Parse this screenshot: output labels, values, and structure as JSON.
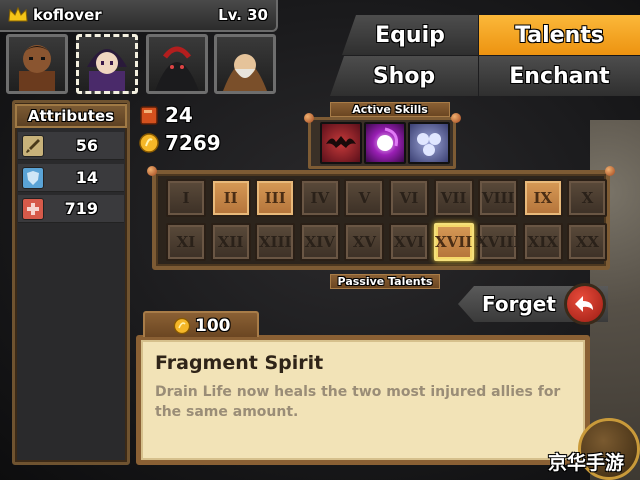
{
  "player": {
    "name": "koflover",
    "level": "Lv. 30",
    "heroes": [
      {
        "name": "hero-warrior"
      },
      {
        "name": "hero-mage",
        "selected": true
      },
      {
        "name": "hero-hooded"
      },
      {
        "name": "hero-monk"
      }
    ]
  },
  "tabs": {
    "equip": "Equip",
    "talents": "Talents",
    "shop": "Shop",
    "enchant": "Enchant",
    "active": "Talents"
  },
  "attributes": {
    "header": "Attributes",
    "rows": [
      {
        "icon": "sword-icon",
        "value": "56",
        "color": "#c8b27a"
      },
      {
        "icon": "shield-icon",
        "value": "14",
        "color": "#5aa3d6"
      },
      {
        "icon": "health-cross-icon",
        "value": "719",
        "color": "#d65a4a"
      }
    ]
  },
  "resources": {
    "books": "24",
    "gold": "7269"
  },
  "active_skills": {
    "label": "Active Skills",
    "skills": [
      "bat-skill-icon",
      "vortex-skill-icon",
      "spirits-skill-icon"
    ]
  },
  "talents": {
    "label": "Passive Talents",
    "row1": [
      "I",
      "II",
      "III",
      "IV",
      "V",
      "VI",
      "VII",
      "VIII",
      "IX",
      "X"
    ],
    "row2": [
      "XI",
      "XII",
      "XIII",
      "XIV",
      "XV",
      "XVI",
      "XVII",
      "XVIII",
      "XIX",
      "XX"
    ],
    "unlocked": [
      "II",
      "III",
      "IX"
    ],
    "selected": "XVII"
  },
  "forget": {
    "label": "Forget"
  },
  "detail": {
    "cost": "100",
    "title": "Fragment Spirit",
    "description": "Drain Life now heals the two most injured allies for the same amount."
  },
  "watermark": "京华手游",
  "colors": {
    "accent": "#f5a623",
    "wood": "#7d5b34",
    "parchment": "#f2e3b7"
  }
}
